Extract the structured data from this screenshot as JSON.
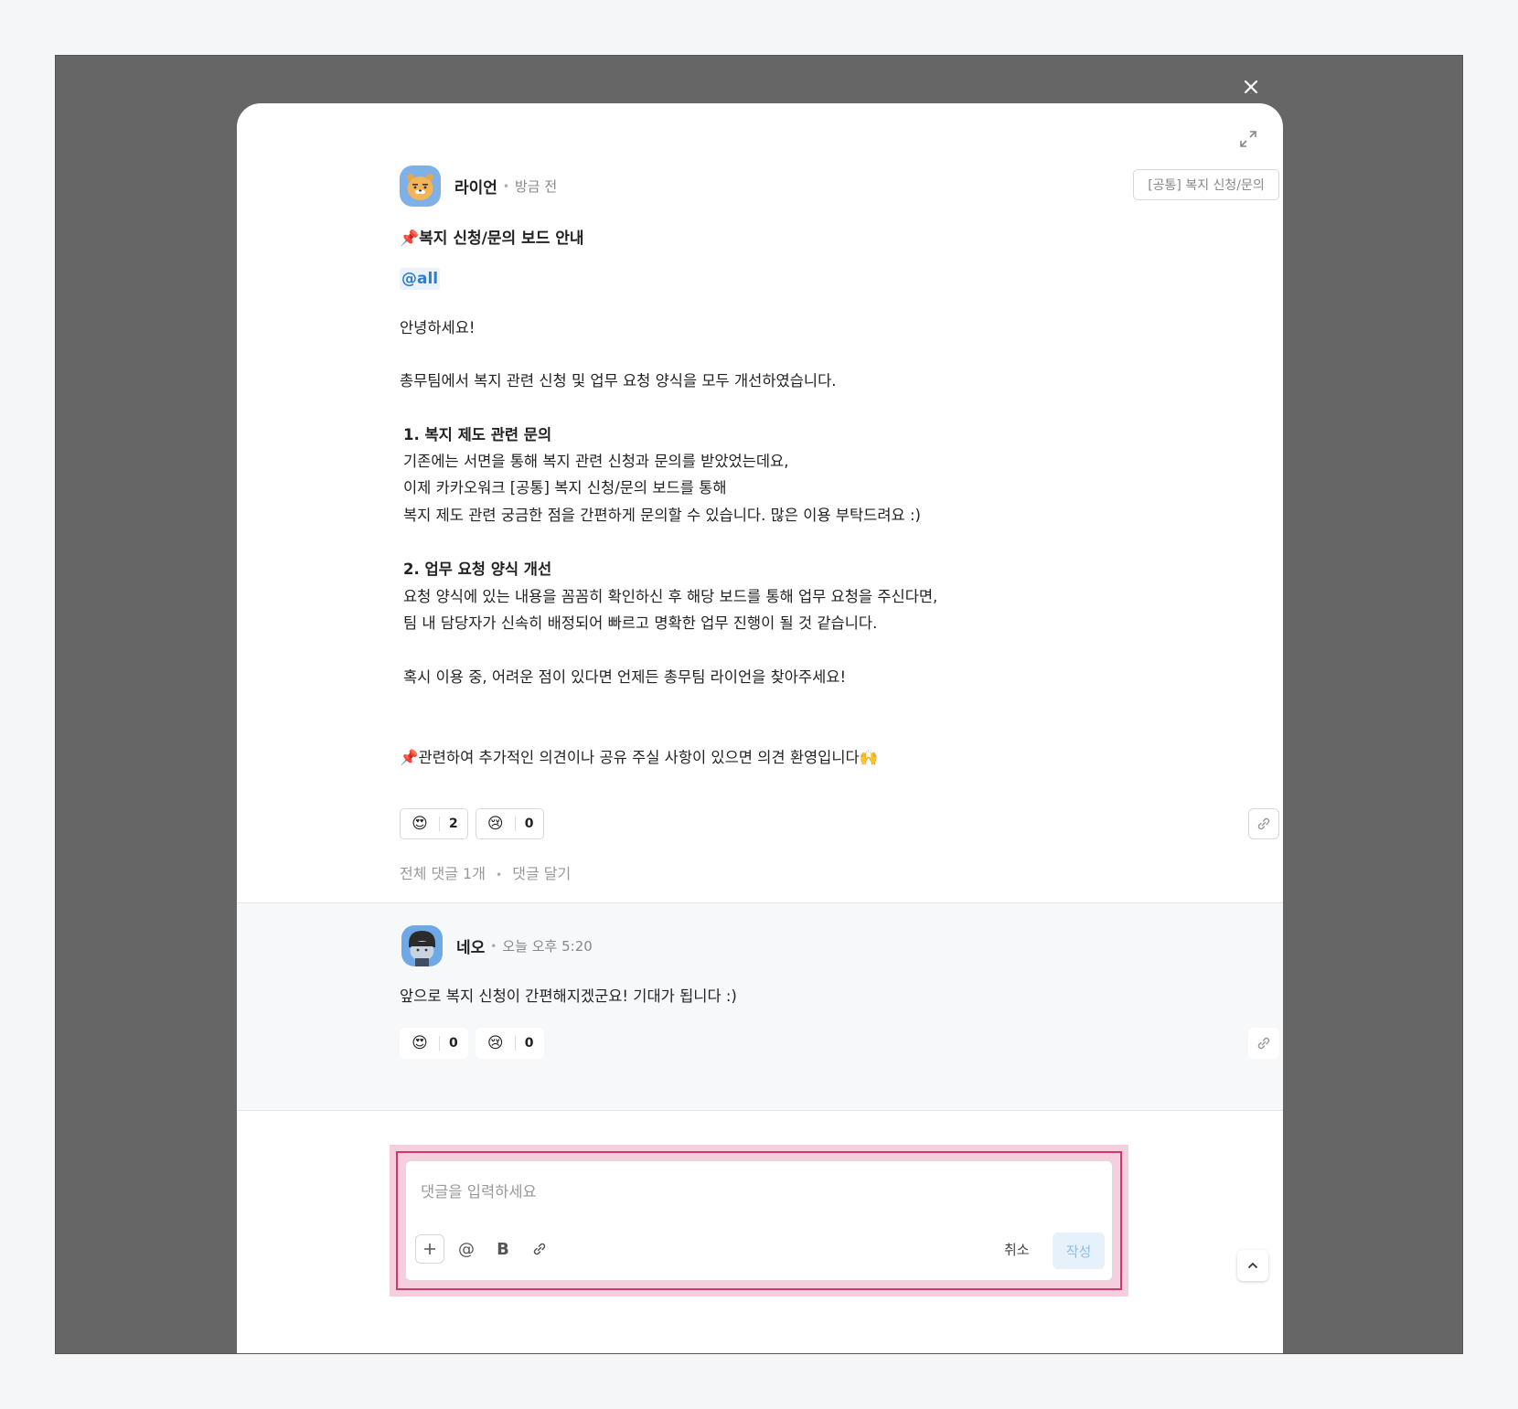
{
  "post": {
    "author": "라이언",
    "time": "방금 전",
    "board": "[공통] 복지 신청/문의",
    "title_icon": "pushpin-icon",
    "title": "복지 신청/문의 보드 안내",
    "mention": "@all",
    "greeting": "안녕하세요!",
    "intro": "총무팀에서 복지 관련 신청 및 업무 요청 양식을 모두 개선하였습니다.",
    "section1_title": "1. 복지 제도 관련 문의",
    "section1_lines": [
      "기존에는 서면을 통해 복지 관련 신청과 문의를 받았었는데요,",
      "이제 카카오워크 [공통] 복지 신청/문의 보드를 통해",
      "복지 제도 관련 궁금한 점을 간편하게 문의할 수 있습니다. 많은 이용 부탁드려요 :)"
    ],
    "section2_title": "2. 업무 요청 양식 개선",
    "section2_lines": [
      "요청 양식에 있는 내용을 꼼꼼히 확인하신 후 해당 보드를 통해 업무 요청을 주신다면,",
      "팀 내 담당자가 신속히 배정되어 빠르고 명확한 업무 진행이 될 것 같습니다."
    ],
    "closing": "혹시 이용 중, 어려운 점이 있다면 언제든 총무팀 라이언을 찾아주세요!",
    "footer_note": "관련하여 추가적인 의견이나 공유 주실 사항이 있으면 의견 환영입니다🙌",
    "reactions": [
      {
        "emoji": "😍",
        "count": "2"
      },
      {
        "emoji": "😢",
        "count": "0"
      }
    ],
    "comment_count": "전체 댓글 1개",
    "reply_link": "댓글 달기"
  },
  "comment": {
    "author": "네오",
    "time": "오늘 오후 5:20",
    "text": "앞으로 복지 신청이 간편해지겠군요! 기대가 됩니다 :)",
    "reactions": [
      {
        "emoji": "😍",
        "count": "0"
      },
      {
        "emoji": "😢",
        "count": "0"
      }
    ]
  },
  "composer": {
    "placeholder": "댓글을 입력하세요",
    "cancel_label": "취소",
    "submit_label": "작성"
  },
  "colors": {
    "backdrop": "#666666",
    "mention": "#2a7fd4",
    "highlight": "#d2376c",
    "submit_bg": "#e6f1fb"
  }
}
